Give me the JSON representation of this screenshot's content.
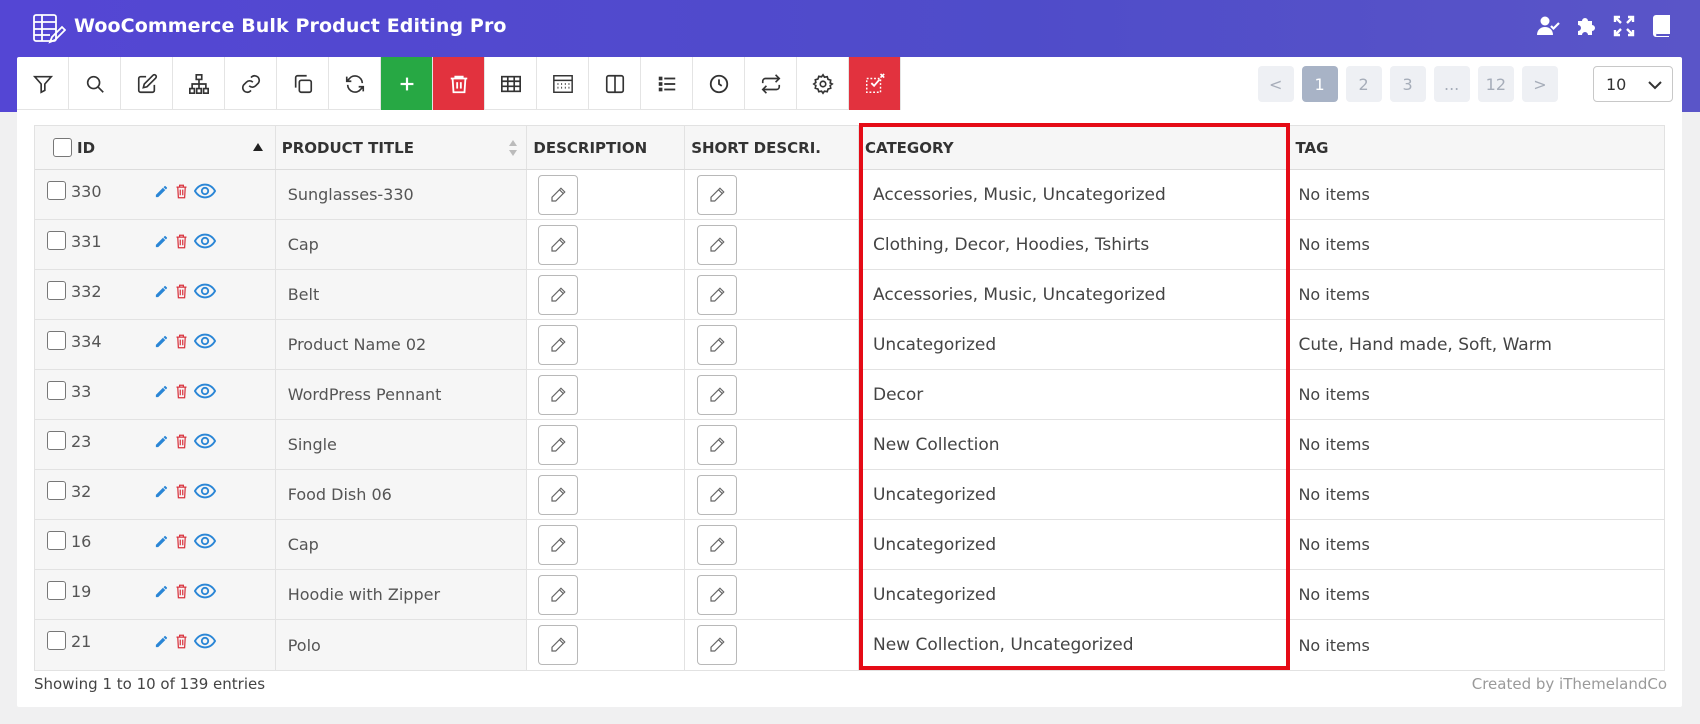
{
  "app": {
    "title": "WooCommerce Bulk Product Editing Pro"
  },
  "top_icons": [
    "user-check-icon",
    "puzzle-icon",
    "fullscreen-icon",
    "book-icon"
  ],
  "toolbar": {
    "buttons": [
      "filter-icon",
      "search-icon",
      "edit-icon",
      "sitemap-icon",
      "link-icon",
      "duplicate-icon",
      "refresh-icon",
      "add-icon",
      "trash-icon",
      "table-icon",
      "calculator-icon",
      "columns-icon",
      "list-icon",
      "history-icon",
      "swap-icon",
      "settings-icon",
      "bind-edit-icon"
    ],
    "accent_green": "#27a844",
    "accent_red": "#e2323e"
  },
  "pagination": {
    "prev": "<",
    "pages": [
      "1",
      "2",
      "3",
      "...",
      "12"
    ],
    "next": ">",
    "active": "1",
    "per_page": "10"
  },
  "table": {
    "columns": {
      "id": "ID",
      "title": "PRODUCT TITLE",
      "description": "DESCRIPTION",
      "short_description": "SHORT DESCRI.",
      "category": "CATEGORY",
      "tag": "TAG"
    },
    "rows": [
      {
        "id": "330",
        "title": "Sunglasses-330",
        "category": "Accessories, Music, Uncategorized",
        "tag": "No items"
      },
      {
        "id": "331",
        "title": "Cap",
        "category": "Clothing, Decor, Hoodies, Tshirts",
        "tag": "No items"
      },
      {
        "id": "332",
        "title": "Belt",
        "category": "Accessories, Music, Uncategorized",
        "tag": "No items"
      },
      {
        "id": "334",
        "title": "Product Name 02",
        "category": "Uncategorized",
        "tag": "Cute, Hand made, Soft, Warm"
      },
      {
        "id": "33",
        "title": "WordPress Pennant",
        "category": "Decor",
        "tag": "No items"
      },
      {
        "id": "23",
        "title": "Single",
        "category": "New Collection",
        "tag": "No items"
      },
      {
        "id": "32",
        "title": "Food Dish 06",
        "category": "Uncategorized",
        "tag": "No items"
      },
      {
        "id": "16",
        "title": "Cap",
        "category": "Uncategorized",
        "tag": "No items"
      },
      {
        "id": "19",
        "title": "Hoodie with Zipper",
        "category": "Uncategorized",
        "tag": "No items"
      },
      {
        "id": "21",
        "title": "Polo",
        "category": "New Collection, Uncategorized",
        "tag": "No items"
      }
    ]
  },
  "footer": {
    "showing": "Showing 1 to 10 of 139 entries",
    "credit": "Created by iThemelandCo"
  },
  "highlight_color": "#e50b16"
}
